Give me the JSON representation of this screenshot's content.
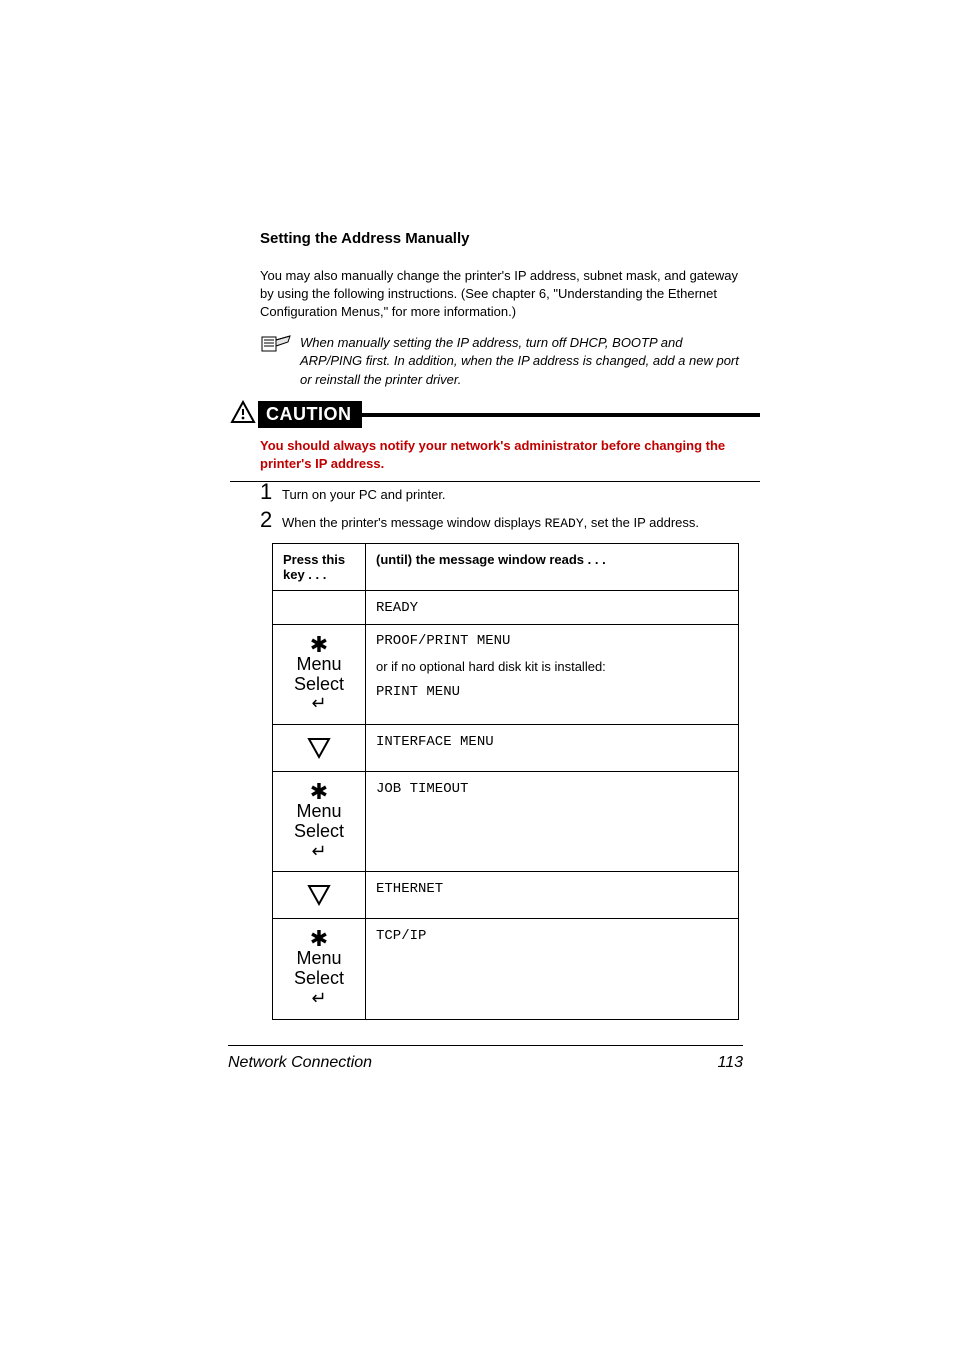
{
  "section_heading": "Setting the Address Manually",
  "intro_para": "You may also manually change the printer's IP address, subnet mask, and gateway by using the following instructions. (See chapter 6, \"Understanding the Ethernet Configuration Menus,\" for more information.)",
  "note_text": "When manually setting the IP address, turn off DHCP, BOOTP and ARP/PING first. In addition, when the IP address is changed, add a new port or reinstall the printer driver.",
  "caution_label": "CAUTION",
  "caution_text": "You should always notify your network's administrator before changing the printer's IP address.",
  "step1_num": "1",
  "step1_text": "Turn on your PC and printer.",
  "step2_num": "2",
  "step2_pre": "When the printer's message window displays ",
  "step2_code": "READY",
  "step2_post": ", set the IP address.",
  "table": {
    "header1": "Press this key . . .",
    "header2": "(until) the message window reads  . . .",
    "row1": {
      "key": "",
      "msg": "READY"
    },
    "row2": {
      "key": "menu",
      "line1": "PROOF/PRINT MENU",
      "mid": "or if no optional hard disk kit is installed:",
      "line2": "PRINT MENU"
    },
    "row3": {
      "key": "down",
      "msg": "INTERFACE MENU"
    },
    "row4": {
      "key": "menu",
      "msg": "JOB TIMEOUT"
    },
    "row5": {
      "key": "down",
      "msg": "ETHERNET"
    },
    "row6": {
      "key": "menu",
      "msg": "TCP/IP"
    }
  },
  "key_labels": {
    "menu": "Menu",
    "select": "Select"
  },
  "footer": {
    "left": "Network Connection",
    "page": "113"
  }
}
